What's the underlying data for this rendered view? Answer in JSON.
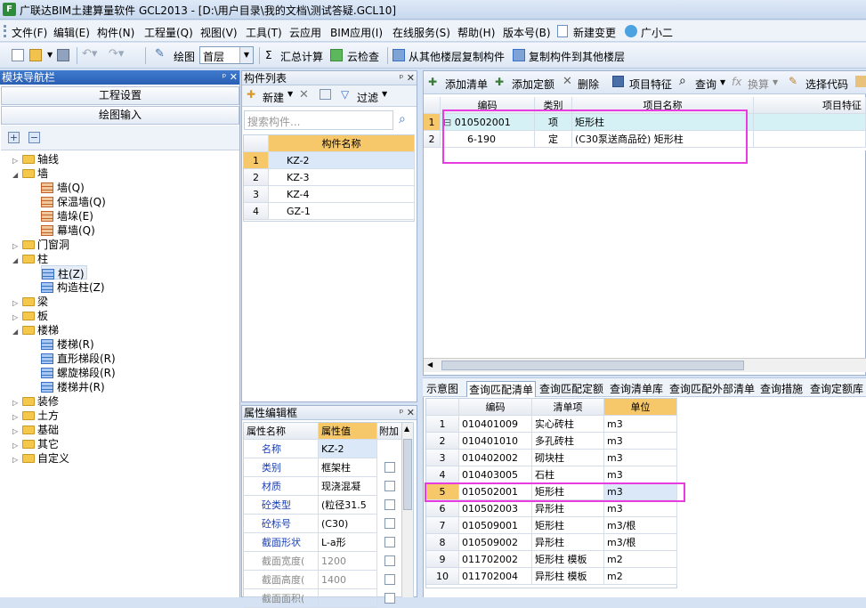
{
  "window": {
    "title": "广联达BIM土建算量软件 GCL2013 - [D:\\用户目录\\我的文档\\测试答疑.GCL10]",
    "icon_text": "F"
  },
  "menu": [
    "文件(F)",
    "编辑(E)",
    "构件(N)",
    "工程量(Q)",
    "视图(V)",
    "工具(T)",
    "云应用",
    "BIM应用(I)",
    "在线服务(S)",
    "帮助(H)",
    "版本号(B)",
    "新建变更",
    "广小二"
  ],
  "toolbar": {
    "draw": "绘图",
    "floor": "首层",
    "sum": "汇总计算",
    "cloud_check": "云检查",
    "copy_from": "从其他楼层复制构件",
    "copy_to": "复制构件到其他楼层"
  },
  "nav": {
    "title": "模块导航栏",
    "btn_settings": "工程设置",
    "btn_draw": "绘图输入",
    "tree": [
      "轴线",
      "墙",
      "墙(Q)",
      "保温墙(Q)",
      "墙垛(E)",
      "幕墙(Q)",
      "门窗洞",
      "柱",
      "柱(Z)",
      "构造柱(Z)",
      "梁",
      "板",
      "楼梯",
      "楼梯(R)",
      "直形梯段(R)",
      "螺旋梯段(R)",
      "楼梯井(R)",
      "装修",
      "土方",
      "基础",
      "其它",
      "自定义"
    ]
  },
  "component_list": {
    "title": "构件列表",
    "new": "新建",
    "filter": "过滤",
    "search_placeholder": "搜索构件...",
    "col_name": "构件名称",
    "rows": [
      {
        "n": "1",
        "name": "KZ-2"
      },
      {
        "n": "2",
        "name": "KZ-3"
      },
      {
        "n": "3",
        "name": "KZ-4"
      },
      {
        "n": "4",
        "name": "GZ-1"
      }
    ]
  },
  "props": {
    "title": "属性编辑框",
    "col_name": "属性名称",
    "col_value": "属性值",
    "col_extra": "附加",
    "rows": [
      {
        "name": "名称",
        "value": "KZ-2"
      },
      {
        "name": "类别",
        "value": "框架柱"
      },
      {
        "name": "材质",
        "value": "现浇混凝"
      },
      {
        "name": "砼类型",
        "value": "(粒径31.5"
      },
      {
        "name": "砼标号",
        "value": "(C30)"
      },
      {
        "name": "截面形状",
        "value": "L-a形"
      },
      {
        "name": "截面宽度(",
        "value": "1200"
      },
      {
        "name": "截面高度(",
        "value": "1400"
      },
      {
        "name": "截面面积(",
        "value": ""
      }
    ]
  },
  "items_toolbar": {
    "add_list": "添加清单",
    "add_quota": "添加定额",
    "delete": "删除",
    "feature": "项目特征",
    "query": "查询",
    "convert": "换算",
    "select_code": "选择代码"
  },
  "items_grid": {
    "headers": [
      "编码",
      "类别",
      "项目名称",
      "项目特征"
    ],
    "rows": [
      {
        "n": "1",
        "code": "010502001",
        "type": "项",
        "name": "矩形柱",
        "tree": "⊟"
      },
      {
        "n": "2",
        "code": "6-190",
        "type": "定",
        "name": "(C30泵送商品砼) 矩形柱",
        "tree": ""
      }
    ]
  },
  "bottom_tabs": [
    "示意图",
    "查询匹配清单",
    "查询匹配定额",
    "查询清单库",
    "查询匹配外部清单",
    "查询措施",
    "查询定额库"
  ],
  "match_grid": {
    "headers": [
      "编码",
      "清单项",
      "单位"
    ],
    "rows": [
      {
        "n": "1",
        "code": "010401009",
        "item": "实心砖柱",
        "unit": "m3"
      },
      {
        "n": "2",
        "code": "010401010",
        "item": "多孔砖柱",
        "unit": "m3"
      },
      {
        "n": "3",
        "code": "010402002",
        "item": "砌块柱",
        "unit": "m3"
      },
      {
        "n": "4",
        "code": "010403005",
        "item": "石柱",
        "unit": "m3"
      },
      {
        "n": "5",
        "code": "010502001",
        "item": "矩形柱",
        "unit": "m3"
      },
      {
        "n": "6",
        "code": "010502003",
        "item": "异形柱",
        "unit": "m3"
      },
      {
        "n": "7",
        "code": "010509001",
        "item": "矩形柱",
        "unit": "m3/根"
      },
      {
        "n": "8",
        "code": "010509002",
        "item": "异形柱",
        "unit": "m3/根"
      },
      {
        "n": "9",
        "code": "011702002",
        "item": "矩形柱 模板",
        "unit": "m2"
      },
      {
        "n": "10",
        "code": "011702004",
        "item": "异形柱 模板",
        "unit": "m2"
      }
    ]
  },
  "colors": {
    "highlight": "#e83ce0",
    "header_orange": "#f7c86a",
    "nav_head": "#2a5fb3"
  }
}
